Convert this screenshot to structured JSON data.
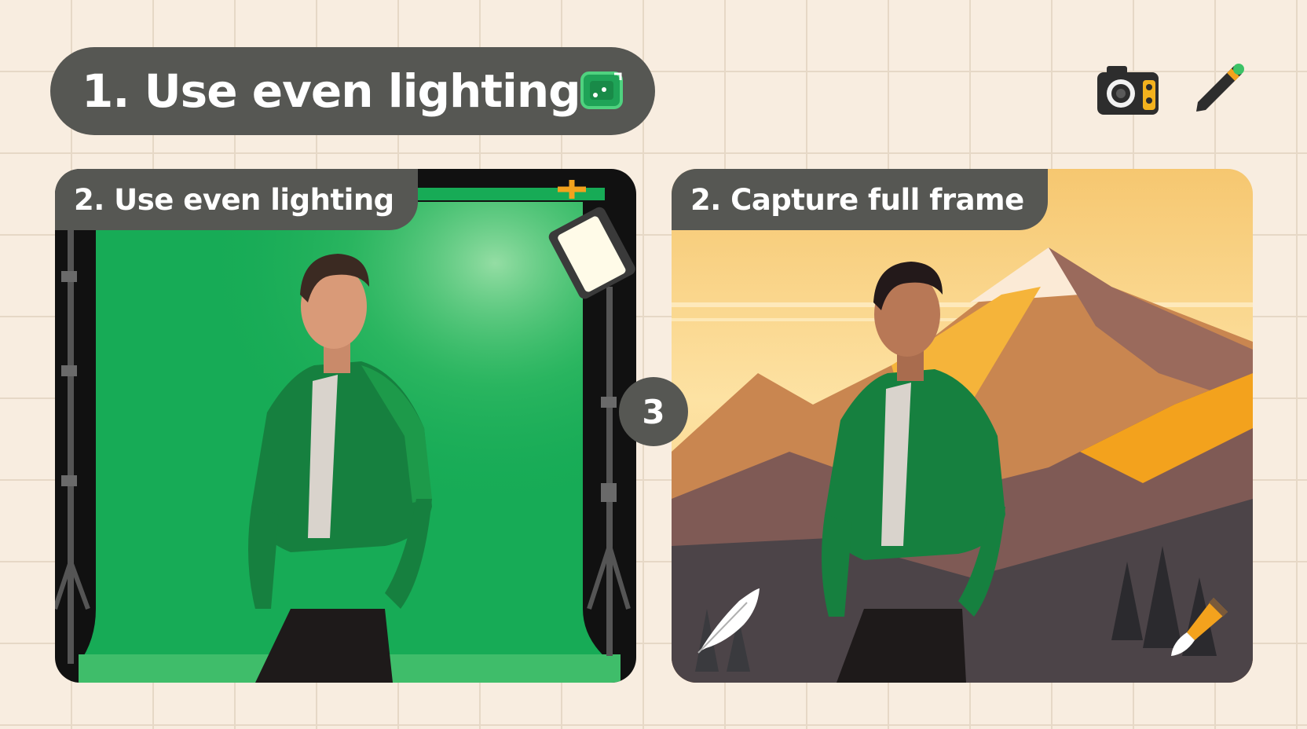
{
  "header": {
    "title": "1. Use even lighting"
  },
  "icons": {
    "title_icon": "green-screen-icon",
    "top_right": [
      "camera-icon",
      "pencil-icon"
    ],
    "panel_right": [
      "feather-icon",
      "paintbrush-icon"
    ]
  },
  "panels": [
    {
      "label": "2. Use even lighting",
      "scene": "green-screen-studio"
    },
    {
      "label": "2. Capture full frame",
      "scene": "mountain-landscape"
    }
  ],
  "step_badge": "3",
  "colors": {
    "background": "#f8ede0",
    "pill": "#565753",
    "green_screen": "#17ab56",
    "accent_orange": "#f3a21d"
  }
}
